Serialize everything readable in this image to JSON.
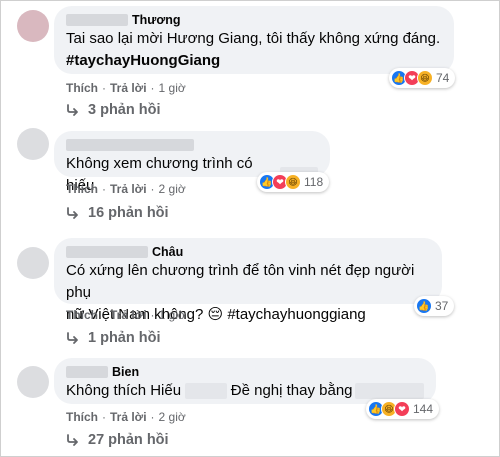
{
  "comments": [
    {
      "author": "Thương",
      "lines": [
        "Tai sao lại mời Hương Giang, tôi thấy không xứng đáng."
      ],
      "hashtag": "#taychayHuongGiang",
      "reaction_count": "74",
      "like_label": "Thích",
      "reply_label": "Trả lời",
      "time": "1 giờ",
      "replies": "3 phản hồi"
    },
    {
      "author": "",
      "lines": [
        "Không xem chương trình có hiếu"
      ],
      "reaction_count": "118",
      "like_label": "Thích",
      "reply_label": "Trả lời",
      "time": "2 giờ",
      "replies": "16 phản hồi"
    },
    {
      "author": "Châu",
      "lines": [
        "Có xứng lên chương trình để tôn vinh nét đẹp người phụ",
        "nữ Việt Nam không? 😔 #taychayhuonggiang"
      ],
      "reaction_count": "37",
      "like_label": "Thích",
      "reply_label": "Trả lời",
      "time": "1 giờ",
      "replies": "1 phản hồi"
    },
    {
      "author": "Bien",
      "lines": [
        "Không thích Hiếu",
        "Đề nghị thay bằng"
      ],
      "reaction_count": "144",
      "like_label": "Thích",
      "reply_label": "Trả lời",
      "time": "2 giờ",
      "replies": "27 phản hồi"
    }
  ],
  "separator": "·"
}
